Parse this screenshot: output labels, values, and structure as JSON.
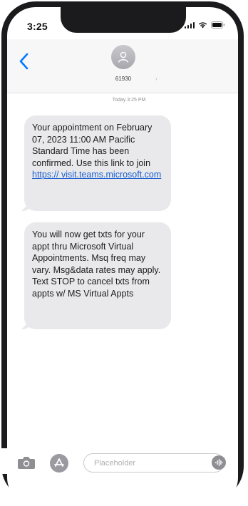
{
  "status_bar": {
    "time": "3:25",
    "icons": [
      "cellular-signal-icon",
      "wifi-icon",
      "battery-icon"
    ]
  },
  "header": {
    "back_icon": "chevron-left-icon",
    "avatar_icon": "person-icon",
    "contact_name": "61930",
    "contact_chevron": "›"
  },
  "thread": {
    "timestamp": "Today 3:25 PM",
    "messages": [
      {
        "text_before_link": "Your appointment on February 07, 2023 11:00 AM Pacific Standard Time has been confirmed. Use this link to join ",
        "link": "https:// visit.teams.microsoft.com"
      },
      {
        "text": "You will now get txts for your appt thru Microsoft Virtual Appointments. Msq freq may vary. Msg&data rates may apply. Text STOP to cancel txts from appts w/ MS Virtual Appts"
      }
    ]
  },
  "composer": {
    "camera_icon": "camera-icon",
    "apps_icon": "app-store-icon",
    "placeholder": "Placeholder",
    "audio_icon": "audio-waveform-icon"
  },
  "colors": {
    "bubble": "#e9e9eb",
    "link": "#1a5fd0",
    "accent": "#007aff",
    "frame": "#1b1b1d"
  }
}
